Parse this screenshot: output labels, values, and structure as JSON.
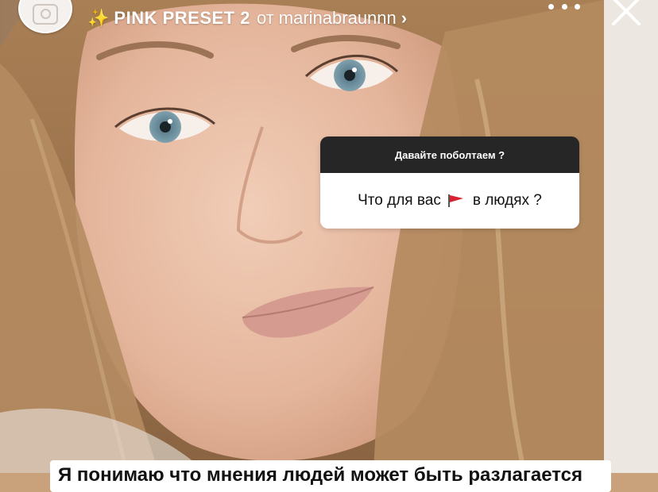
{
  "header": {
    "effect_name": "PINK PRESET 2",
    "effect_by": "от",
    "effect_author": "marinabraunnn",
    "sparkle_icon": "✨",
    "chevron_icon": "›"
  },
  "question_sticker": {
    "title": "Давайте поболтаем ?",
    "text_before": "Что для вас",
    "emoji": "red-flag",
    "text_after": "в людях ?"
  },
  "caption": {
    "text": "Я понимаю что мнения людей может быть разлагается"
  },
  "colors": {
    "sticker_header": "#262626",
    "sticker_body": "#ffffff",
    "flag": "#d6232f"
  }
}
